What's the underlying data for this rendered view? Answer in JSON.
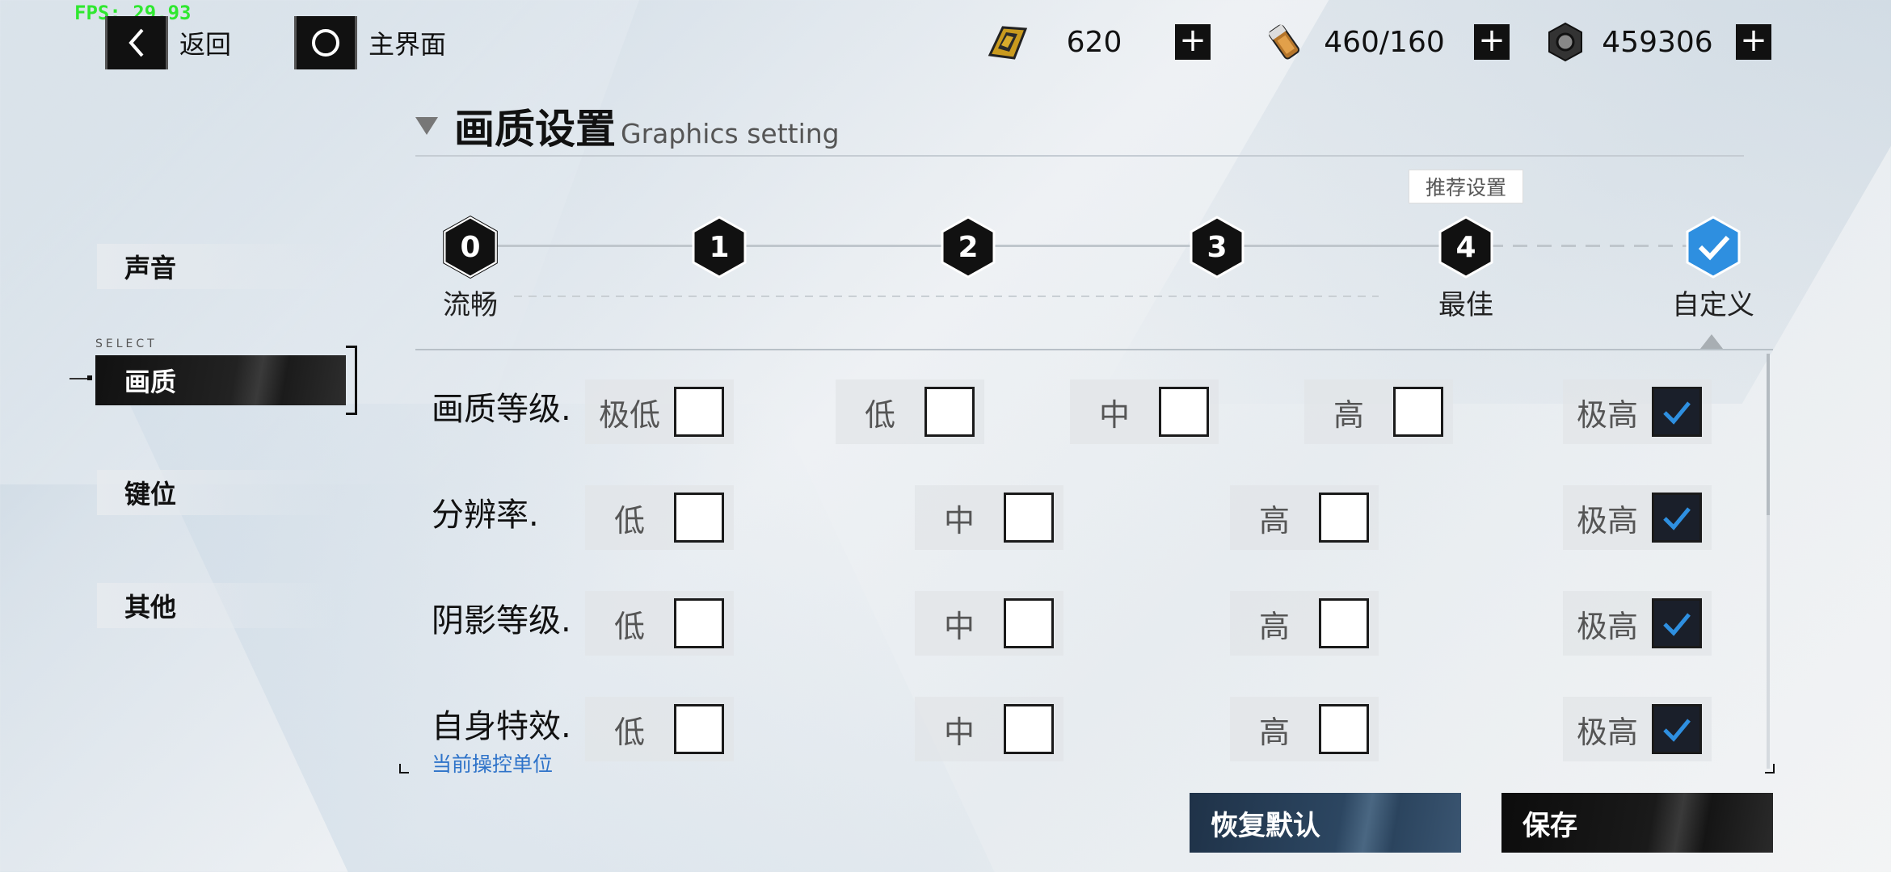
{
  "fps": "FPS: 29.93",
  "topbar": {
    "back_label": "返回",
    "home_label": "主界面",
    "resources": [
      {
        "icon": "gold-bar-icon",
        "value": "620"
      },
      {
        "icon": "battery-can-icon",
        "value": "460/160"
      },
      {
        "icon": "hex-nut-icon",
        "value": "459306"
      }
    ],
    "plus_label": "+"
  },
  "sidebar": {
    "items": [
      {
        "label": "声音"
      },
      {
        "label": "画质",
        "active": true
      },
      {
        "label": "键位"
      },
      {
        "label": "其他"
      }
    ],
    "select_tag": "SELECT"
  },
  "header": {
    "title_cn": "画质设置",
    "title_en": "Graphics setting"
  },
  "presets": {
    "recommend_label": "推荐设置",
    "items": [
      {
        "num": "0",
        "label": "流畅"
      },
      {
        "num": "1",
        "label": ""
      },
      {
        "num": "2",
        "label": ""
      },
      {
        "num": "3",
        "label": ""
      },
      {
        "num": "4",
        "label": "最佳"
      },
      {
        "num": "",
        "label": "自定义",
        "selected": true
      }
    ]
  },
  "settings": [
    {
      "name": "画质等级.",
      "options": [
        "极低",
        "低",
        "中",
        "高",
        "极高"
      ],
      "selected": "极高"
    },
    {
      "name": "分辨率.",
      "options": [
        "低",
        "中",
        "高",
        "极高"
      ],
      "selected": "极高"
    },
    {
      "name": "阴影等级.",
      "options": [
        "低",
        "中",
        "高",
        "极高"
      ],
      "selected": "极高"
    },
    {
      "name": "自身特效.",
      "sub": "当前操控单位",
      "options": [
        "低",
        "中",
        "高",
        "极高"
      ],
      "selected": "极高"
    }
  ],
  "buttons": {
    "reset": "恢复默认",
    "save": "保存"
  },
  "colors": {
    "check_accent": "#2e8fe0",
    "sub_text": "#2e73c9"
  }
}
